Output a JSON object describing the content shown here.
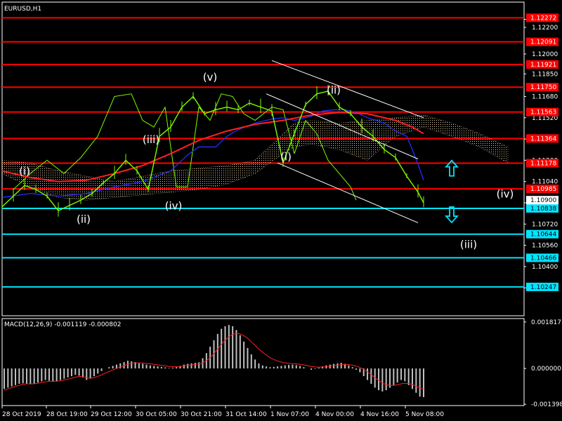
{
  "window": {
    "symbol_label": "EURUSD,H1",
    "macd_label": "MACD(12,26,9) -0.001119 -0.000802"
  },
  "colors": {
    "background": "#000000",
    "frame": "#ffffff",
    "price": "#7cfc00",
    "ma_red": "#ff2020",
    "ma_blue": "#2030ff",
    "cloud": "#f5deb3",
    "resistance": "#ff0000",
    "support": "#00e5ff",
    "channel": "#ffffff",
    "histogram": "#c0c0c0",
    "signal": "#ff2020"
  },
  "chart_data": {
    "type": "line",
    "symbol": "EURUSD",
    "timeframe": "H1",
    "y_range": [
      1.1003,
      1.1239
    ],
    "y_ticks": [
      "1.12260",
      "1.12200",
      "1.12000",
      "1.11850",
      "1.11680",
      "1.11520",
      "1.11360",
      "1.11200",
      "1.11040",
      "1.10880",
      "1.10720",
      "1.10560",
      "1.10400",
      "1.10240"
    ],
    "x_ticks": [
      "28 Oct 2019",
      "28 Oct 19:00",
      "29 Oct 12:00",
      "30 Oct 05:00",
      "30 Oct 21:00",
      "31 Oct 14:00",
      "1 Nov 07:00",
      "4 Nov 00:00",
      "4 Nov 16:00",
      "5 Nov 08:00"
    ],
    "x_range": [
      0,
      150
    ],
    "current_price": "1.10900",
    "resistance_levels": [
      {
        "value": 1.12272,
        "label": "1.12272"
      },
      {
        "value": 1.12091,
        "label": "1.12091"
      },
      {
        "value": 1.11921,
        "label": "1.11921"
      },
      {
        "value": 1.1175,
        "label": "1.11750"
      },
      {
        "value": 1.11563,
        "label": "1.11563"
      },
      {
        "value": 1.11364,
        "label": "1.11364"
      },
      {
        "value": 1.11178,
        "label": "1.11178"
      },
      {
        "value": 1.10985,
        "label": "1.10985"
      }
    ],
    "support_levels": [
      {
        "value": 1.10838,
        "label": "1.10838"
      },
      {
        "value": 1.10644,
        "label": "1.10644"
      },
      {
        "value": 1.10466,
        "label": "1.10466"
      },
      {
        "value": 1.10247,
        "label": "1.10247"
      }
    ],
    "series": [
      {
        "key": "price",
        "x": [
          0,
          4,
          8,
          12,
          16,
          20,
          24,
          28,
          32,
          36,
          40,
          44,
          48,
          52,
          56,
          60,
          64,
          68,
          72,
          76,
          80,
          84,
          88,
          92,
          96,
          100,
          104,
          108,
          112,
          116,
          120,
          124,
          128,
          132,
          136,
          140,
          144,
          148,
          150
        ],
        "values": [
          1.1085,
          1.1093,
          1.1101,
          1.1098,
          1.1093,
          1.1082,
          1.1086,
          1.109,
          1.1095,
          1.1103,
          1.111,
          1.112,
          1.1112,
          1.1098,
          1.1138,
          1.1145,
          1.116,
          1.1168,
          1.1155,
          1.1158,
          1.116,
          1.1158,
          1.1163,
          1.116,
          1.1157,
          1.1118,
          1.114,
          1.1162,
          1.117,
          1.1172,
          1.116,
          1.1155,
          1.1145,
          1.1138,
          1.1128,
          1.1122,
          1.1108,
          1.1096,
          1.1088
        ]
      },
      {
        "key": "ma_red",
        "x": [
          0,
          10,
          20,
          30,
          40,
          50,
          60,
          70,
          80,
          90,
          100,
          110,
          120,
          130,
          140,
          146,
          150
        ],
        "values": [
          1.1112,
          1.1107,
          1.1104,
          1.1105,
          1.111,
          1.1116,
          1.1125,
          1.1135,
          1.1142,
          1.1147,
          1.115,
          1.1154,
          1.1156,
          1.1155,
          1.115,
          1.1145,
          1.114
        ]
      },
      {
        "key": "ma_blue",
        "x": [
          0,
          10,
          20,
          30,
          40,
          50,
          60,
          66,
          70,
          76,
          80,
          84,
          90,
          96,
          100,
          104,
          110,
          114,
          118,
          122,
          126,
          130,
          136,
          140,
          144,
          146,
          148,
          150
        ],
        "values": [
          1.1092,
          1.1095,
          1.1093,
          1.1095,
          1.11,
          1.1104,
          1.1112,
          1.1124,
          1.113,
          1.113,
          1.1138,
          1.1143,
          1.1148,
          1.1151,
          1.1152,
          1.115,
          1.1153,
          1.1157,
          1.1158,
          1.1158,
          1.1156,
          1.1152,
          1.1148,
          1.1142,
          1.1138,
          1.1128,
          1.1117,
          1.1105
        ]
      },
      {
        "key": "cloud_upper",
        "x": [
          0,
          10,
          20,
          30,
          40,
          50,
          60,
          70,
          80,
          90,
          100,
          104,
          110,
          120,
          130,
          140,
          150,
          160,
          170,
          180
        ],
        "values": [
          1.112,
          1.1118,
          1.1112,
          1.1108,
          1.1104,
          1.1108,
          1.1112,
          1.1114,
          1.1116,
          1.112,
          1.114,
          1.1148,
          1.115,
          1.1148,
          1.115,
          1.1152,
          1.1154,
          1.1148,
          1.114,
          1.113
        ]
      },
      {
        "key": "cloud_lower",
        "x": [
          0,
          10,
          20,
          30,
          40,
          50,
          60,
          70,
          80,
          90,
          100,
          104,
          110,
          120,
          130,
          140,
          150,
          160,
          170,
          180
        ],
        "values": [
          1.111,
          1.11,
          1.1092,
          1.109,
          1.1092,
          1.1094,
          1.1096,
          1.1098,
          1.1102,
          1.111,
          1.1125,
          1.113,
          1.1132,
          1.1128,
          1.112,
          1.1138,
          1.1145,
          1.1138,
          1.113,
          1.1118
        ]
      },
      {
        "key": "lagging",
        "x": [
          4,
          10,
          16,
          22,
          28,
          34,
          40,
          46,
          50,
          54,
          58,
          62,
          66,
          70,
          74,
          78,
          82,
          86,
          90,
          96,
          100,
          104,
          108,
          112,
          116,
          120,
          124,
          126
        ],
        "values": [
          1.1098,
          1.111,
          1.112,
          1.111,
          1.1122,
          1.1138,
          1.1168,
          1.117,
          1.115,
          1.1145,
          1.116,
          1.11,
          1.11,
          1.116,
          1.115,
          1.117,
          1.1168,
          1.1155,
          1.115,
          1.116,
          1.1158,
          1.1125,
          1.115,
          1.114,
          1.112,
          1.111,
          1.11,
          1.109
        ]
      }
    ],
    "channel": [
      {
        "x1": 96,
        "y1": 1.1195,
        "x2": 150,
        "y2": 1.1152
      },
      {
        "x1": 94,
        "y1": 1.117,
        "x2": 148,
        "y2": 1.1121
      },
      {
        "x1": 98,
        "y1": 1.1118,
        "x2": 148,
        "y2": 1.1073
      }
    ],
    "wave_labels": [
      {
        "text": "(i)",
        "x": 8,
        "y": 1.1109
      },
      {
        "text": "(ii)",
        "x": 29,
        "y": 1.1073
      },
      {
        "text": "(iii)",
        "x": 53,
        "y": 1.1133
      },
      {
        "text": "(iv)",
        "x": 61,
        "y": 1.1083
      },
      {
        "text": "(v)",
        "x": 74,
        "y": 1.118
      },
      {
        "text": "(i)",
        "x": 101,
        "y": 1.112
      },
      {
        "text": "(ii)",
        "x": 118,
        "y": 1.117
      },
      {
        "text": "(iv)",
        "x": 179,
        "y": 1.1092
      },
      {
        "text": "(iii)",
        "x": 166,
        "y": 1.1054
      }
    ],
    "arrows": [
      {
        "direction": "up",
        "x": 160,
        "y": 1.1114,
        "color": "#00e5ff"
      },
      {
        "direction": "down",
        "x": 160,
        "y": 1.1079,
        "color": "#00e5ff"
      }
    ],
    "macd": {
      "y_range": [
        -0.00145,
        0.00195
      ],
      "y_ticks": [
        "0.001817",
        "0.000000",
        "-0.001398"
      ],
      "histogram": [
        -0.0008,
        -0.00075,
        -0.0007,
        -0.00065,
        -0.0006,
        -0.00058,
        -0.0006,
        -0.00062,
        -0.0006,
        -0.00055,
        -0.0005,
        -0.00045,
        -0.00048,
        -0.00052,
        -0.0005,
        -0.00045,
        -0.0004,
        -0.00035,
        -0.0003,
        -0.00025,
        -0.00028,
        -0.00035,
        -0.00045,
        -0.0004,
        -0.0003,
        -0.0002,
        -0.0001,
        0.0,
        5e-05,
        0.0001,
        0.00015,
        0.0002,
        0.00025,
        0.0003,
        0.00028,
        0.00025,
        0.0002,
        0.00018,
        0.00015,
        0.00012,
        0.0001,
        8e-05,
        6e-05,
        4e-05,
        2e-05,
        3e-05,
        5e-05,
        0.0001,
        0.00015,
        0.00018,
        0.0002,
        0.00022,
        0.00024,
        0.0004,
        0.0006,
        0.00085,
        0.0011,
        0.00135,
        0.00155,
        0.00165,
        0.0017,
        0.00165,
        0.0015,
        0.0013,
        0.00105,
        0.0008,
        0.00055,
        0.00035,
        0.0002,
        0.00012,
        8e-05,
        5e-05,
        6e-05,
        8e-05,
        0.0001,
        0.00012,
        0.00014,
        0.00015,
        0.00013,
        0.0001,
        5e-05,
        0.0,
        -5e-05,
        -2e-05,
        3e-05,
        8e-05,
        0.00012,
        0.00015,
        0.00018,
        0.0002,
        0.00022,
        0.00018,
        0.00012,
        5e-05,
        -5e-05,
        -0.00015,
        -0.0003,
        -0.00045,
        -0.0006,
        -0.00075,
        -0.00085,
        -0.0009,
        -0.00085,
        -0.00075,
        -0.00065,
        -0.00055,
        -0.00045,
        -0.0005,
        -0.00065,
        -0.0008,
        -0.00095,
        -0.0011,
        -0.00112
      ],
      "signal": [
        -0.00085,
        -0.0008,
        -0.00075,
        -0.0007,
        -0.00066,
        -0.00062,
        -0.0006,
        -0.0006,
        -0.0006,
        -0.00058,
        -0.00055,
        -0.00052,
        -0.0005,
        -0.0005,
        -0.0005,
        -0.00048,
        -0.00045,
        -0.00042,
        -0.00038,
        -0.00034,
        -0.00031,
        -0.00032,
        -0.00036,
        -0.00038,
        -0.00036,
        -0.00031,
        -0.00025,
        -0.00018,
        -0.00012,
        -6e-05,
        0.0,
        6e-05,
        0.00011,
        0.00016,
        0.0002,
        0.00022,
        0.00022,
        0.00021,
        0.0002,
        0.00018,
        0.00016,
        0.00014,
        0.00012,
        0.0001,
        8e-05,
        7e-05,
        7e-05,
        8e-05,
        0.0001,
        0.00012,
        0.00014,
        0.00016,
        0.00018,
        0.00022,
        0.0003,
        0.00042,
        0.00058,
        0.00076,
        0.00094,
        0.0011,
        0.00124,
        0.00133,
        0.00137,
        0.00135,
        0.00128,
        0.00118,
        0.00104,
        0.0009,
        0.00076,
        0.00063,
        0.00052,
        0.00042,
        0.00035,
        0.00029,
        0.00025,
        0.00022,
        0.0002,
        0.00019,
        0.00018,
        0.00016,
        0.00014,
        0.00011,
        8e-05,
        6e-05,
        5e-05,
        6e-05,
        7e-05,
        9e-05,
        0.00011,
        0.00013,
        0.00015,
        0.00016,
        0.00015,
        0.00013,
        9e-05,
        4e-05,
        -4e-05,
        -0.00013,
        -0.00024,
        -0.00036,
        -0.00047,
        -0.00057,
        -0.00063,
        -0.00066,
        -0.00066,
        -0.00064,
        -0.0006,
        -0.00058,
        -0.00059,
        -0.00063,
        -0.00069,
        -0.00076,
        -0.0008
      ]
    }
  }
}
